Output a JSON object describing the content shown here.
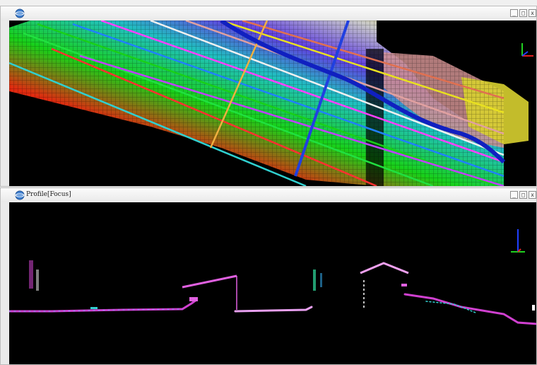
{
  "windows": [
    {
      "id": "plan-view",
      "title": "",
      "buttons": [
        "_",
        "□",
        "x"
      ]
    },
    {
      "id": "profile-view",
      "title": "Profile[Focus]",
      "buttons": [
        "_",
        "□",
        "x"
      ]
    }
  ],
  "icons": {
    "app": "globe-app-icon",
    "minimize": "minimize-icon",
    "maximize": "maximize-icon",
    "close": "close-icon",
    "axis": "axis-triad-icon"
  },
  "colors": {
    "background": "#000000",
    "window_frame": "#f3f3f3",
    "red_points": "#e01010",
    "green_points": "#18d018",
    "blue_points": "#1830d0",
    "yellow_points": "#e8e020",
    "magenta_profile": "#d040d0"
  }
}
